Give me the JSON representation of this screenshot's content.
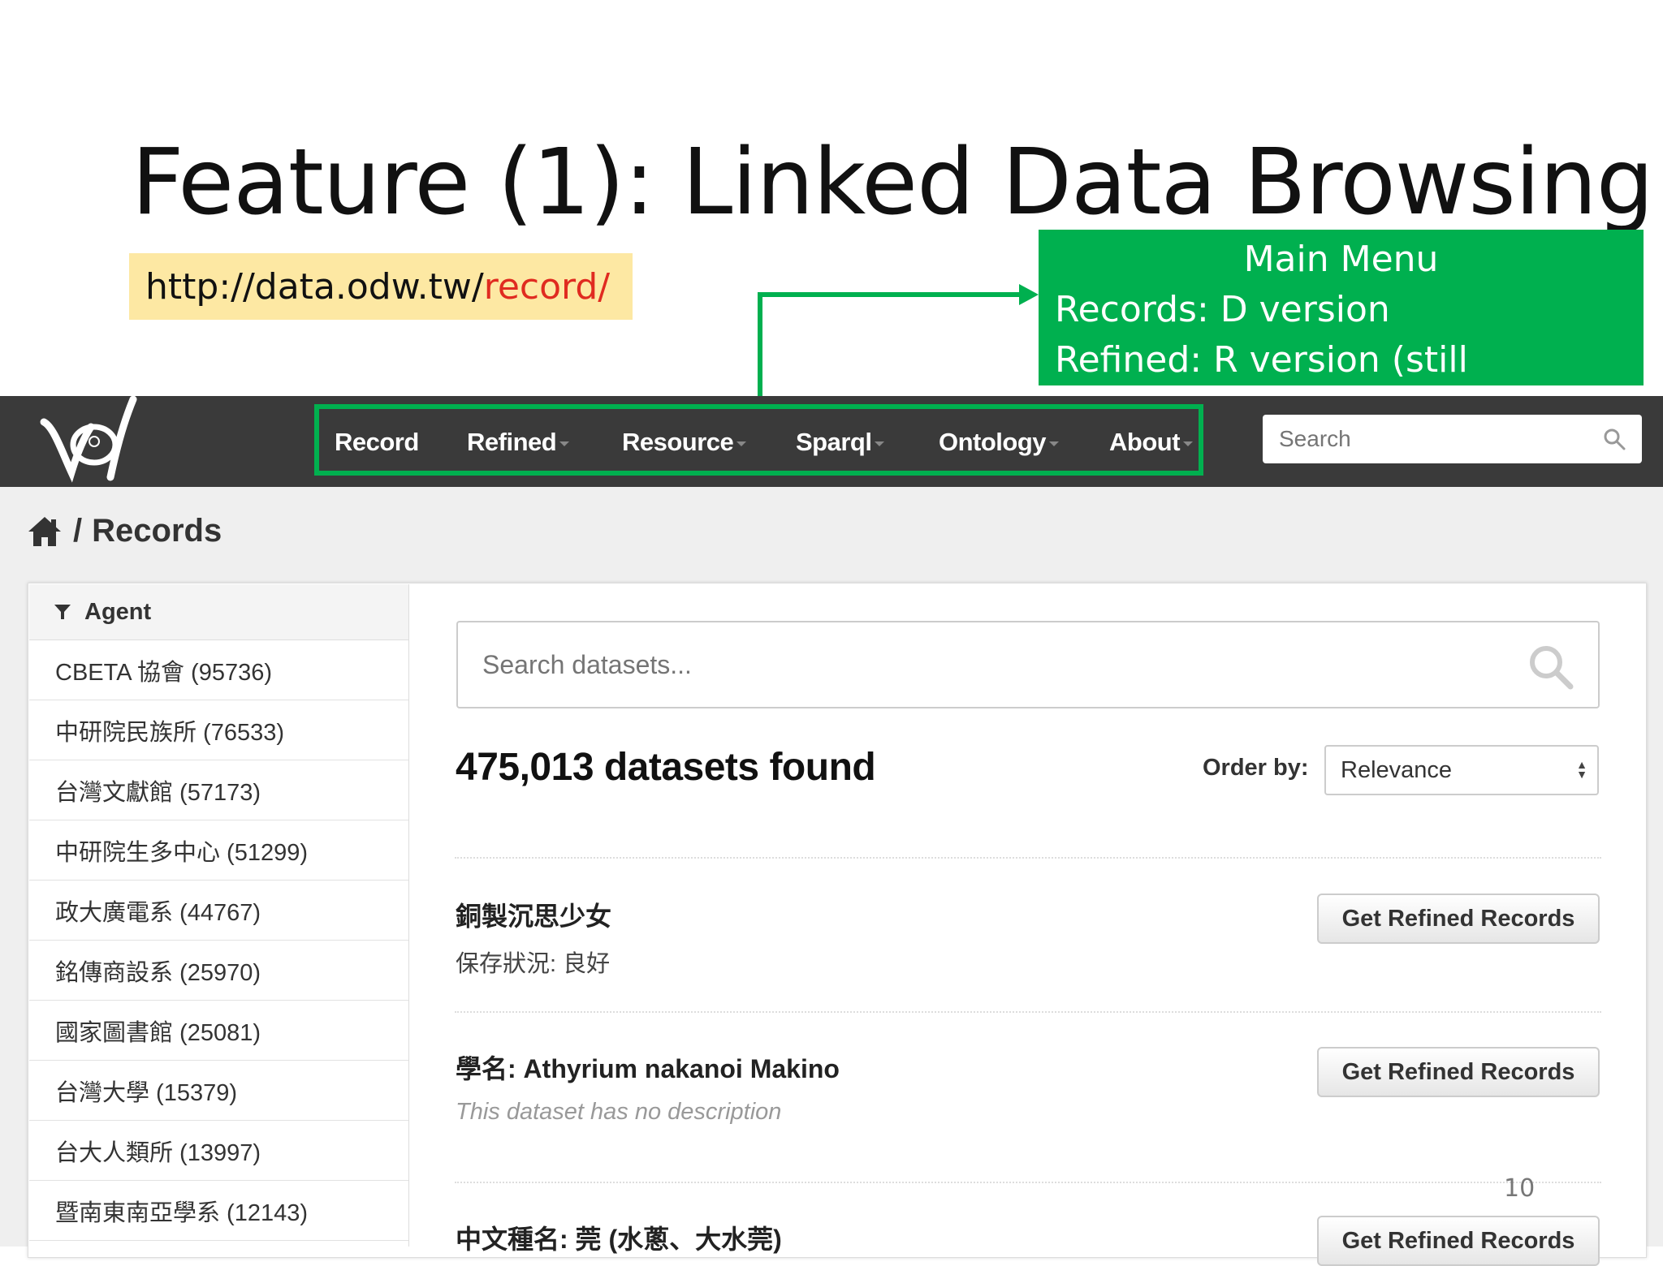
{
  "slide": {
    "title": "Feature (1): Linked Data Browsing",
    "url_base": "http://data.odw.tw/",
    "url_highlight": "record/",
    "page_number": "10"
  },
  "callout": {
    "title": "Main Menu",
    "line1": "Records: D version",
    "line2": "Refined: R version (still uploading)"
  },
  "navbar": {
    "items": [
      {
        "label": "Record",
        "dropdown": false
      },
      {
        "label": "Refined",
        "dropdown": true
      },
      {
        "label": "Resource",
        "dropdown": true
      },
      {
        "label": "Sparql",
        "dropdown": true
      },
      {
        "label": "Ontology",
        "dropdown": true
      },
      {
        "label": "About",
        "dropdown": true
      }
    ],
    "search_placeholder": "Search"
  },
  "breadcrumb": {
    "separator": "/",
    "current": "Records"
  },
  "sidebar": {
    "heading": "Agent",
    "items": [
      {
        "label": "CBETA 協會 (95736)"
      },
      {
        "label": "中研院民族所 (76533)"
      },
      {
        "label": "台灣文獻館 (57173)"
      },
      {
        "label": "中研院生多中心 (51299)"
      },
      {
        "label": "政大廣電系 (44767)"
      },
      {
        "label": "銘傳商設系 (25970)"
      },
      {
        "label": "國家圖書館 (25081)"
      },
      {
        "label": "台灣大學 (15379)"
      },
      {
        "label": "台大人類所 (13997)"
      },
      {
        "label": "暨南東南亞學系 (12143)"
      }
    ]
  },
  "main": {
    "search_placeholder": "Search datasets...",
    "found_text": "475,013 datasets found",
    "order_label": "Order by:",
    "order_value": "Relevance",
    "datasets": [
      {
        "title": "銅製沉思少女",
        "description": "保存狀況: 良好",
        "button": "Get Refined Records"
      },
      {
        "title": "學名: Athyrium nakanoi Makino",
        "description": "This dataset has no description",
        "button": "Get Refined Records"
      },
      {
        "title": "中文種名: 莞 (水蔥、大水莞)",
        "description": "",
        "button": "Get Refined Records"
      }
    ]
  }
}
